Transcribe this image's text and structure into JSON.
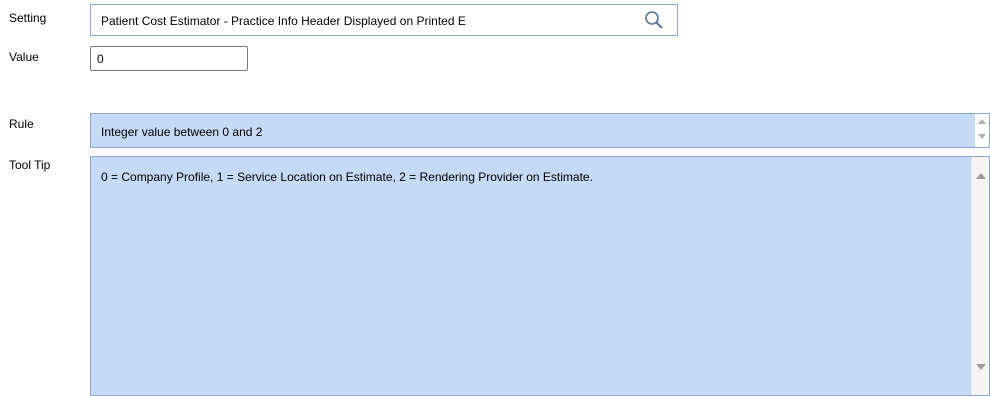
{
  "labels": {
    "setting": "Setting",
    "value": "Value",
    "rule": "Rule",
    "tooltip": "Tool Tip"
  },
  "setting": {
    "value": "Patient Cost Estimator - Practice Info Header Displayed on Printed E",
    "search_icon": "search-icon"
  },
  "value_field": {
    "value": "0"
  },
  "rule": {
    "text": "Integer value between 0 and 2"
  },
  "tooltip": {
    "text": "0 = Company Profile, 1 = Service Location on Estimate, 2 = Rendering Provider on Estimate."
  },
  "colors": {
    "readonly_bg": "#c6d9f5",
    "border": "#8fa8cf"
  }
}
